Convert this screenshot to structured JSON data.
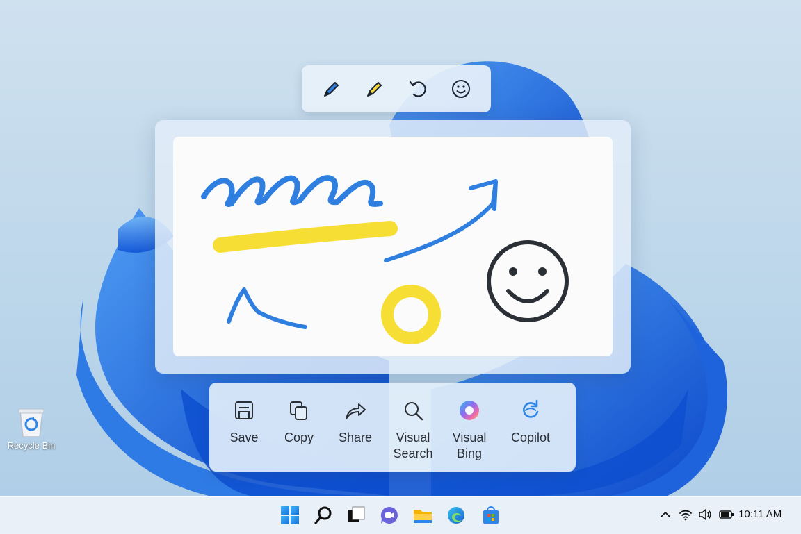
{
  "desktop": {
    "recycle_bin_label": "Recycle Bin"
  },
  "pen_toolbar": {
    "tools": [
      "blue-pen-icon",
      "yellow-highlighter-icon",
      "undo-icon",
      "emoji-icon"
    ]
  },
  "canvas": {
    "colors": {
      "blue_ink": "#2f7fe0",
      "yellow_ink": "#f7de35",
      "dark_ink": "#2b2f36"
    }
  },
  "actions": {
    "save": "Save",
    "copy": "Copy",
    "share": "Share",
    "visual_search_line1": "Visual",
    "visual_search_line2": "Search",
    "visual_bing_line1": "Visual",
    "visual_bing_line2": "Bing",
    "copilot": "Copilot"
  },
  "taskbar": {
    "apps": [
      "start-icon",
      "search-icon",
      "task-view-icon",
      "teams-icon",
      "file-explorer-icon",
      "edge-icon",
      "store-icon"
    ],
    "tray": [
      "chevron-up-icon",
      "wifi-icon",
      "volume-icon",
      "battery-icon"
    ],
    "time": "10:11 AM"
  }
}
